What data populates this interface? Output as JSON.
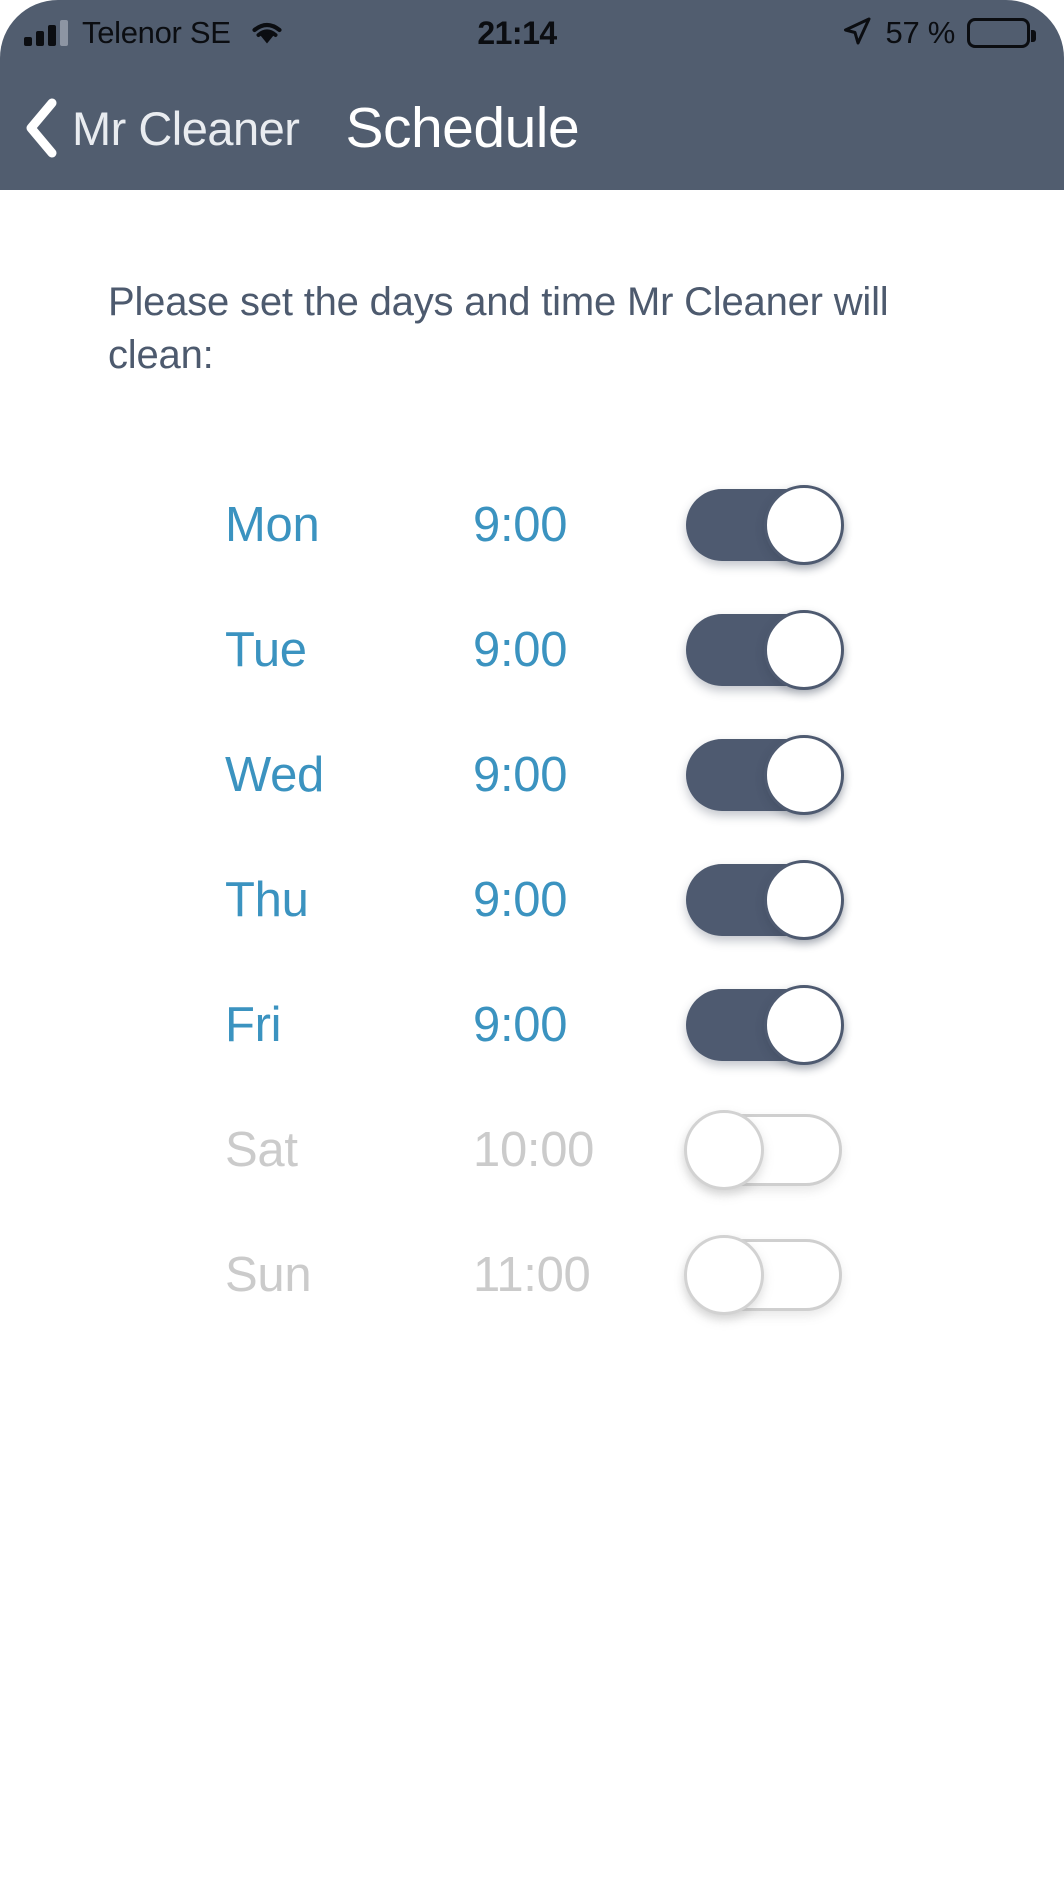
{
  "status_bar": {
    "carrier": "Telenor SE",
    "time": "21:14",
    "battery_percent": "57 %",
    "battery_level": 57,
    "signal_bars_filled": 3,
    "signal_bars_total": 4,
    "wifi_icon": "wifi-icon",
    "location_icon": "location-arrow-icon",
    "battery_icon": "battery-icon"
  },
  "nav_bar": {
    "back_icon": "chevron-left-icon",
    "back_label": "Mr Cleaner",
    "title": "Schedule"
  },
  "main": {
    "instructions": "Please set the days and time Mr Cleaner will clean:",
    "rows": [
      {
        "day": "Mon",
        "time": "9:00",
        "enabled": true
      },
      {
        "day": "Tue",
        "time": "9:00",
        "enabled": true
      },
      {
        "day": "Wed",
        "time": "9:00",
        "enabled": true
      },
      {
        "day": "Thu",
        "time": "9:00",
        "enabled": true
      },
      {
        "day": "Fri",
        "time": "9:00",
        "enabled": true
      },
      {
        "day": "Sat",
        "time": "10:00",
        "enabled": false
      },
      {
        "day": "Sun",
        "time": "11:00",
        "enabled": false
      }
    ]
  },
  "colors": {
    "header_background": "#515D6F",
    "accent_blue": "#3B93C0",
    "toggle_on": "#4E5A70",
    "toggle_off_border": "#CFCFCF",
    "disabled_text": "#CBCBCB",
    "instruction_text": "#4D5A6E",
    "page_background": "#FFFFFF"
  }
}
